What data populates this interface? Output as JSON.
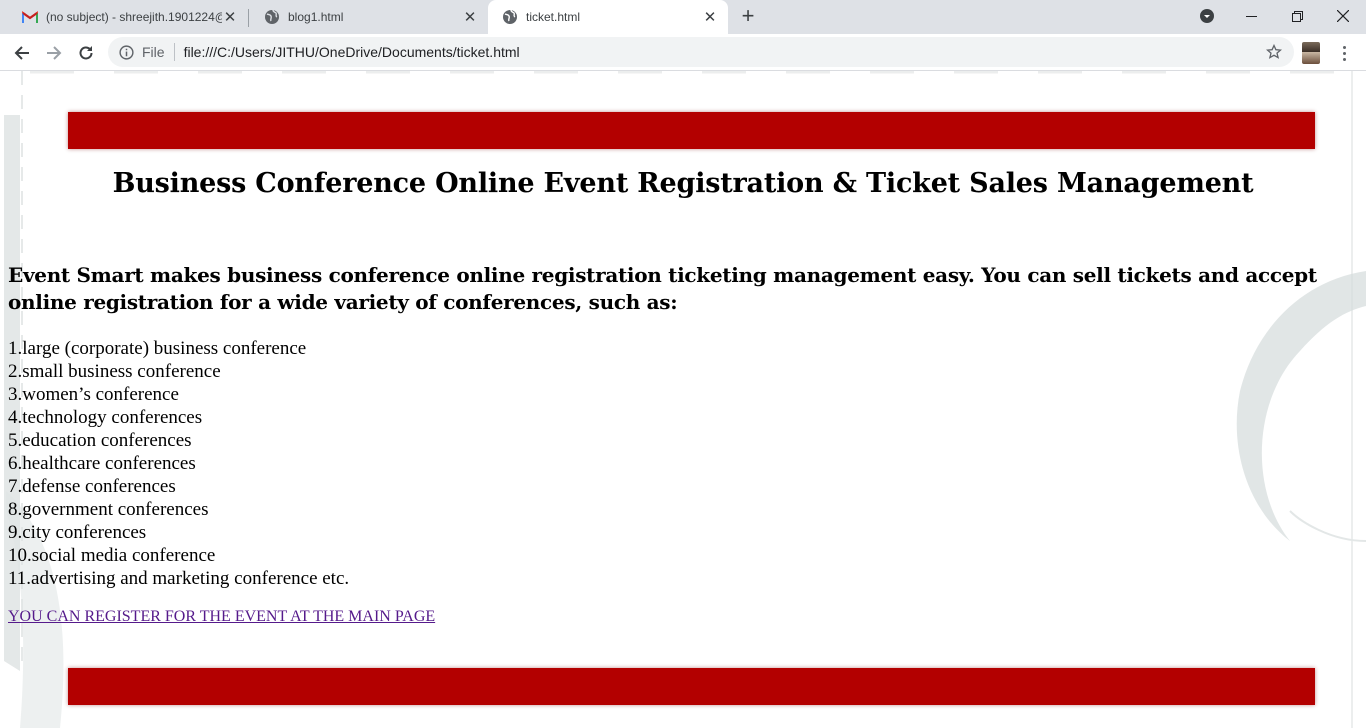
{
  "browser": {
    "tabs": [
      {
        "title": "(no subject) - shreejith.1901224@",
        "favicon": "gmail-icon",
        "active": false
      },
      {
        "title": "blog1.html",
        "favicon": "globe-icon",
        "active": false
      },
      {
        "title": "ticket.html",
        "favicon": "globe-icon",
        "active": true
      }
    ],
    "address": {
      "scheme_label": "File",
      "url": "file:///C:/Users/JITHU/OneDrive/Documents/ticket.html"
    },
    "colors": {
      "tabstrip": "#dee1e6",
      "omnibox": "#f1f3f4"
    }
  },
  "page": {
    "title": "Business Conference Online Event Registration & Ticket Sales Management",
    "intro": "Event Smart makes business conference online registration ticketing management easy. You can sell tickets and accept online registration for a wide variety of conferences, such as:",
    "conferences": [
      "1.large (corporate) business conference",
      "2.small business conference",
      "3.women’s conference",
      "4.technology conferences",
      "5.education conferences",
      "6.healthcare conferences",
      "7.defense conferences",
      "8.government conferences",
      "9.city conferences",
      "10.social media conference",
      "11.advertising and marketing conference etc."
    ],
    "register_link": "YOU CAN REGISTER FOR THE EVENT AT THE MAIN PAGE",
    "colors": {
      "banner": "#b30000",
      "link": "#551a8b"
    }
  }
}
